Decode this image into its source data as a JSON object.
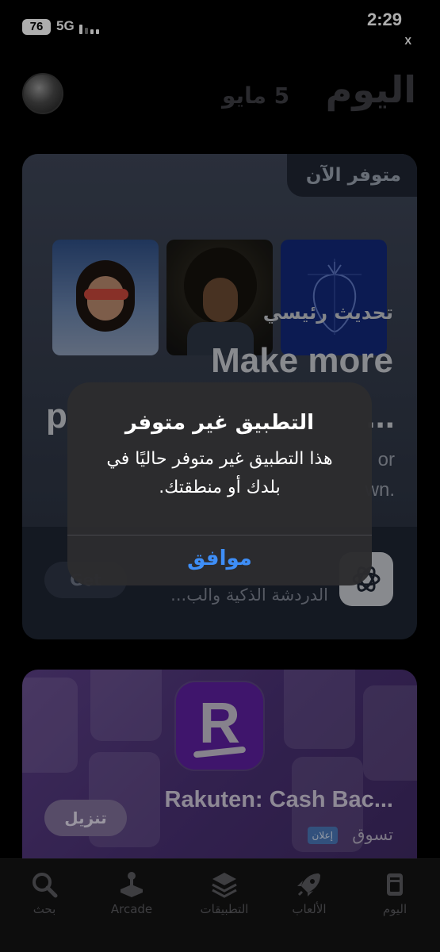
{
  "status_bar": {
    "battery": "76",
    "network": "5G",
    "time": "2:29",
    "back_label": "X"
  },
  "header": {
    "title": "اليوم",
    "date": "5 مايو"
  },
  "feature_card": {
    "badge": "متوفر الآن",
    "subtitle": "تحديث رئيسي",
    "title_line1": "Make more",
    "title_line2_left": "p",
    "title_line2_right": "...",
    "desc_line1_visible": "or",
    "desc_line2_visible": "wn.",
    "app_name": "الدردشة الذكية والب...",
    "get_button": "Get"
  },
  "rakuten_card": {
    "title": "Rakuten: Cash Bac...",
    "category": "تسوق",
    "ad_label": "إعلان",
    "install_button": "تنزيل",
    "icon_letter": "R"
  },
  "alert": {
    "title": "التطبيق غير متوفر",
    "message_line1": "هذا التطبيق غير متوفر حاليًا في",
    "message_line2": "بلدك أو منطقتك.",
    "ok_button": "موافق"
  },
  "tabbar": {
    "tabs": [
      {
        "label": "اليوم",
        "icon": "today-icon"
      },
      {
        "label": "الألعاب",
        "icon": "rocket-icon"
      },
      {
        "label": "التطبيقات",
        "icon": "layers-icon"
      },
      {
        "label": "Arcade",
        "icon": "joystick-icon"
      },
      {
        "label": "بحث",
        "icon": "search-icon"
      }
    ]
  },
  "colors": {
    "alert_button": "#3e8ef7",
    "alert_bg": "#2c2c2e",
    "rakuten_purple": "#5e1fa0"
  }
}
